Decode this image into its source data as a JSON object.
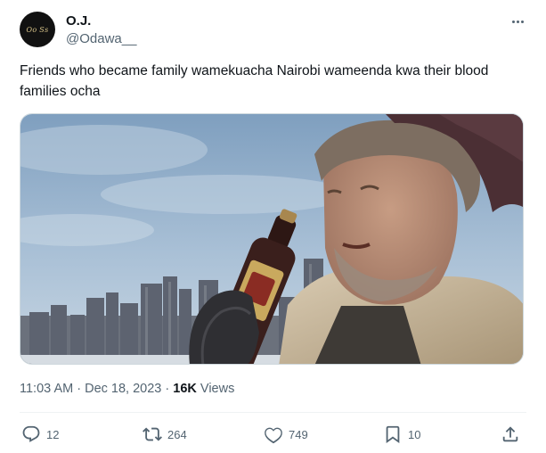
{
  "author": {
    "display_name": "O.J.",
    "handle": "@Odawa__",
    "avatar_text": "Oo Ss"
  },
  "tweet": {
    "text": "Friends who became family wamekuacha Nairobi wameenda kwa their blood families ocha",
    "time": "11:03 AM",
    "date": "Dec 18, 2023",
    "separator": "·",
    "views_count": "16K",
    "views_label": "Views"
  },
  "media": {
    "description_icon": "photo",
    "bottle_label_color": "#c9a95e"
  },
  "actions": {
    "replies": "12",
    "reposts": "264",
    "likes": "749",
    "bookmarks": "10"
  },
  "icons": {
    "reply": "reply-icon",
    "repost": "repost-icon",
    "like": "heart-icon",
    "bookmark": "bookmark-icon",
    "share": "share-icon",
    "more": "more-icon"
  },
  "colors": {
    "text_primary": "#0f1419",
    "text_secondary": "#536471",
    "divider": "#eff3f4"
  }
}
